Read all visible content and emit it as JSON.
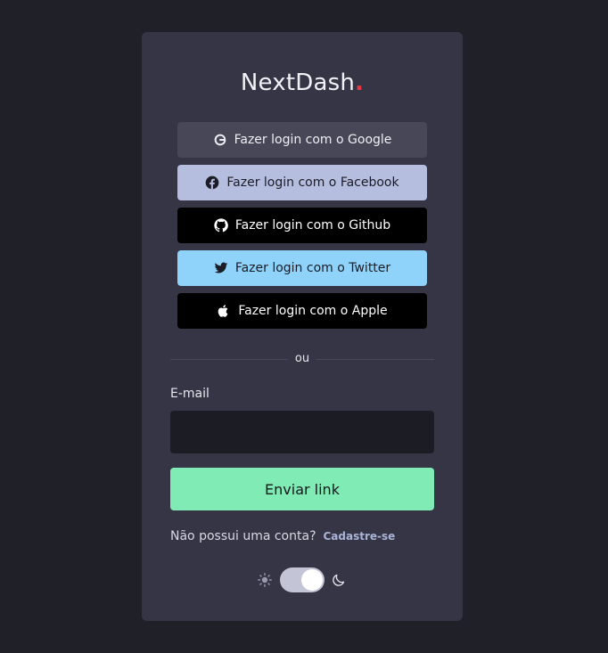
{
  "app": {
    "logo_text": "NextDash",
    "logo_dot": "."
  },
  "social_buttons": [
    {
      "label": "Fazer login com o Google",
      "icon": "google-icon"
    },
    {
      "label": "Fazer login com o Facebook",
      "icon": "facebook-icon"
    },
    {
      "label": "Fazer login com o Github",
      "icon": "github-icon"
    },
    {
      "label": "Fazer login com o Twitter",
      "icon": "twitter-icon"
    },
    {
      "label": "Fazer login com o Apple",
      "icon": "apple-icon"
    }
  ],
  "divider": {
    "text": "ou"
  },
  "form": {
    "email_label": "E-mail",
    "email_value": "",
    "email_placeholder": "",
    "submit_label": "Enviar link"
  },
  "signup": {
    "text": "Não possui uma conta?",
    "link": "Cadastre-se"
  },
  "theme": {
    "light_icon": "sun-icon",
    "dark_icon": "moon-icon",
    "mode": "dark"
  },
  "colors": {
    "background": "#202029",
    "card": "#363546",
    "google": "#484757",
    "facebook": "#b6bedf",
    "github": "#000000",
    "twitter": "#8fd3fb",
    "apple": "#000000",
    "submit": "#80ebb5",
    "logo_dot": "#e63946"
  }
}
